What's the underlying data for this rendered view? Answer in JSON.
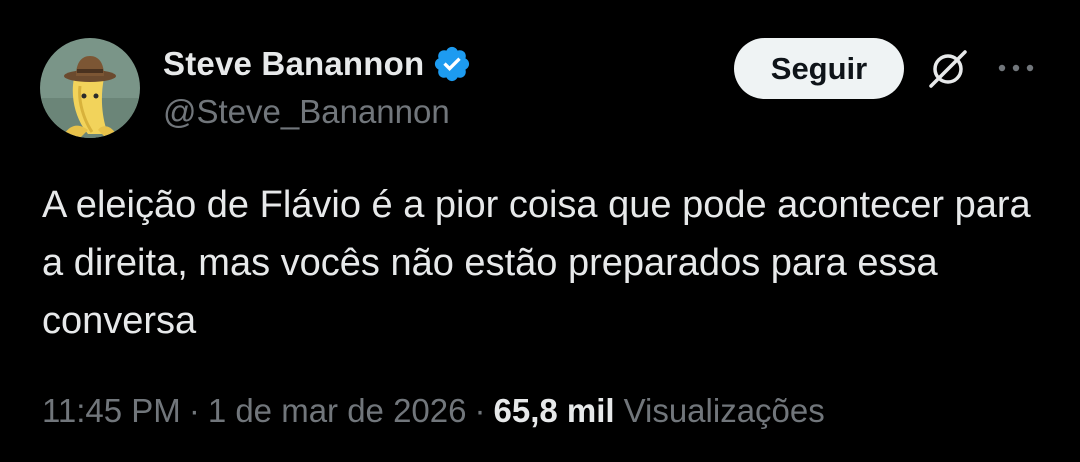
{
  "author": {
    "display_name": "Steve Banannon",
    "handle": "@Steve_Banannon",
    "verified": true,
    "verified_color": "#1d9bf0"
  },
  "actions": {
    "follow_label": "Seguir",
    "grok_icon": "grok-icon",
    "more_icon": "more-dots-icon"
  },
  "tweet": {
    "text": "A eleição de Flávio é a pior coisa que pode acontecer para a direita, mas vocês não estão preparados para essa conversa",
    "time": "11:45 PM",
    "date": "1 de mar de 2026",
    "separator": "·",
    "views_count": "65,8 mil",
    "views_label": "Visualizações"
  },
  "colors": {
    "background": "#000000",
    "primary_text": "#e7e9ea",
    "secondary_text": "#71767b",
    "button_bg": "#eff3f4"
  }
}
